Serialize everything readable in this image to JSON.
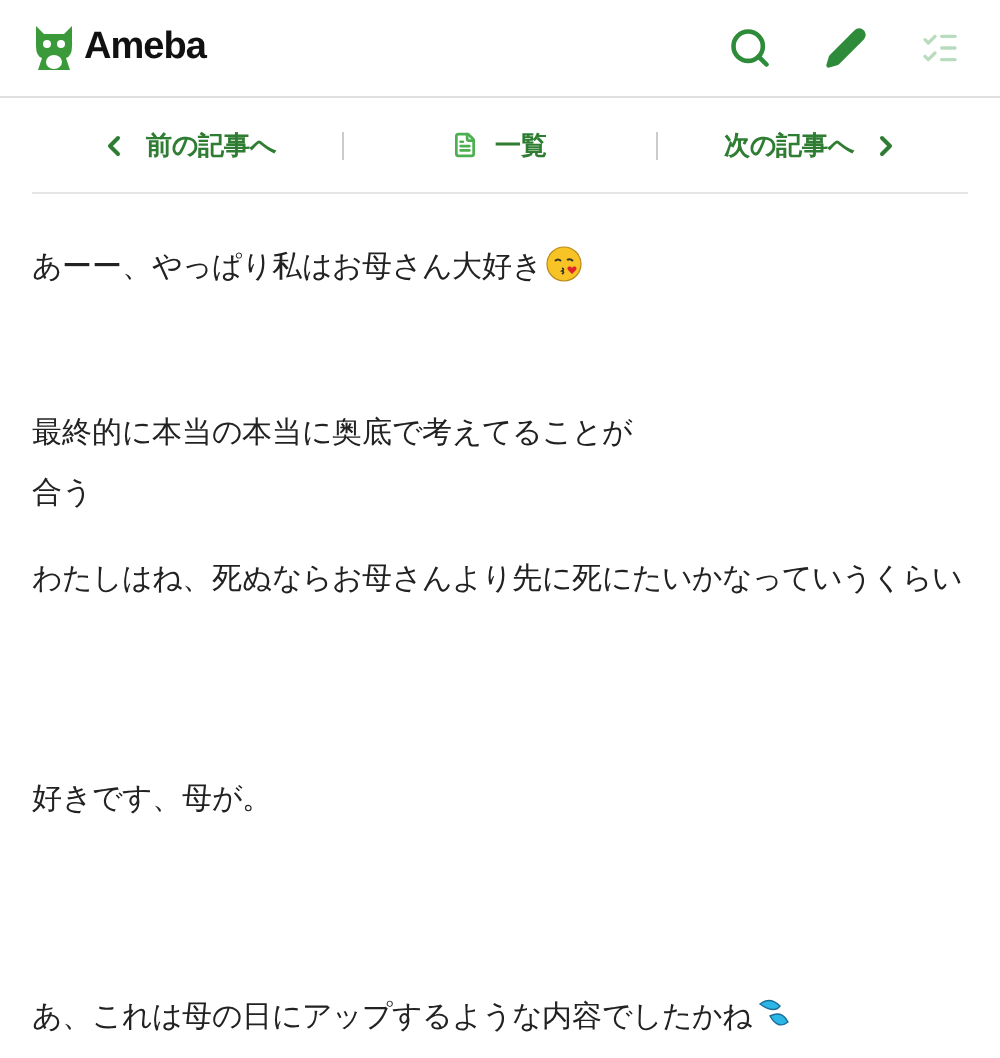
{
  "header": {
    "logo": "Ameba"
  },
  "nav": {
    "previous": "前の記事へ",
    "list": "一覧",
    "next": "次の記事へ"
  },
  "paragraphs": [
    {
      "text": "あーー、やっぱり私はお母さん大好き",
      "kind": "kiss"
    },
    {
      "text": "最終的に本当の本当に奥底で考えてることが",
      "kind": "plain"
    },
    {
      "text": "合う",
      "kind": "plain"
    },
    {
      "text": "わたしはね、死ぬならお母さんより先に死にたいかなっていうくらい",
      "kind": "plain"
    },
    {
      "text": "好きです、母が。",
      "kind": "plain"
    },
    {
      "text": "あ、これは母の日にアップするような内容でしたかね",
      "kind": "sweat"
    }
  ]
}
